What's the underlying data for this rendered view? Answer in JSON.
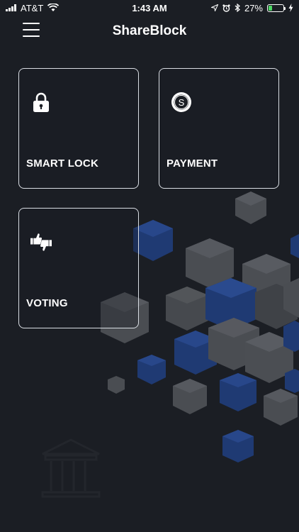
{
  "status_bar": {
    "carrier": "AT&T",
    "time": "1:43 AM",
    "battery_percent": "27%",
    "battery_level": 0.27,
    "icons": [
      "signal-icon",
      "wifi-icon",
      "location-icon",
      "alarm-icon",
      "bluetooth-icon",
      "battery-icon",
      "charging-icon"
    ]
  },
  "nav": {
    "title": "ShareBlock",
    "menu_icon": "hamburger-icon"
  },
  "tiles": [
    {
      "label": "SMART LOCK",
      "icon": "lock-icon"
    },
    {
      "label": "PAYMENT",
      "icon": "coin-s-icon"
    },
    {
      "label": "VOTING",
      "icon": "thumbs-up-down-icon"
    }
  ],
  "colors": {
    "background": "#1b1e24",
    "accent_blue": "#1f3a73",
    "cube_gray": "#4a4d52",
    "tile_border": "#d9dde3"
  }
}
